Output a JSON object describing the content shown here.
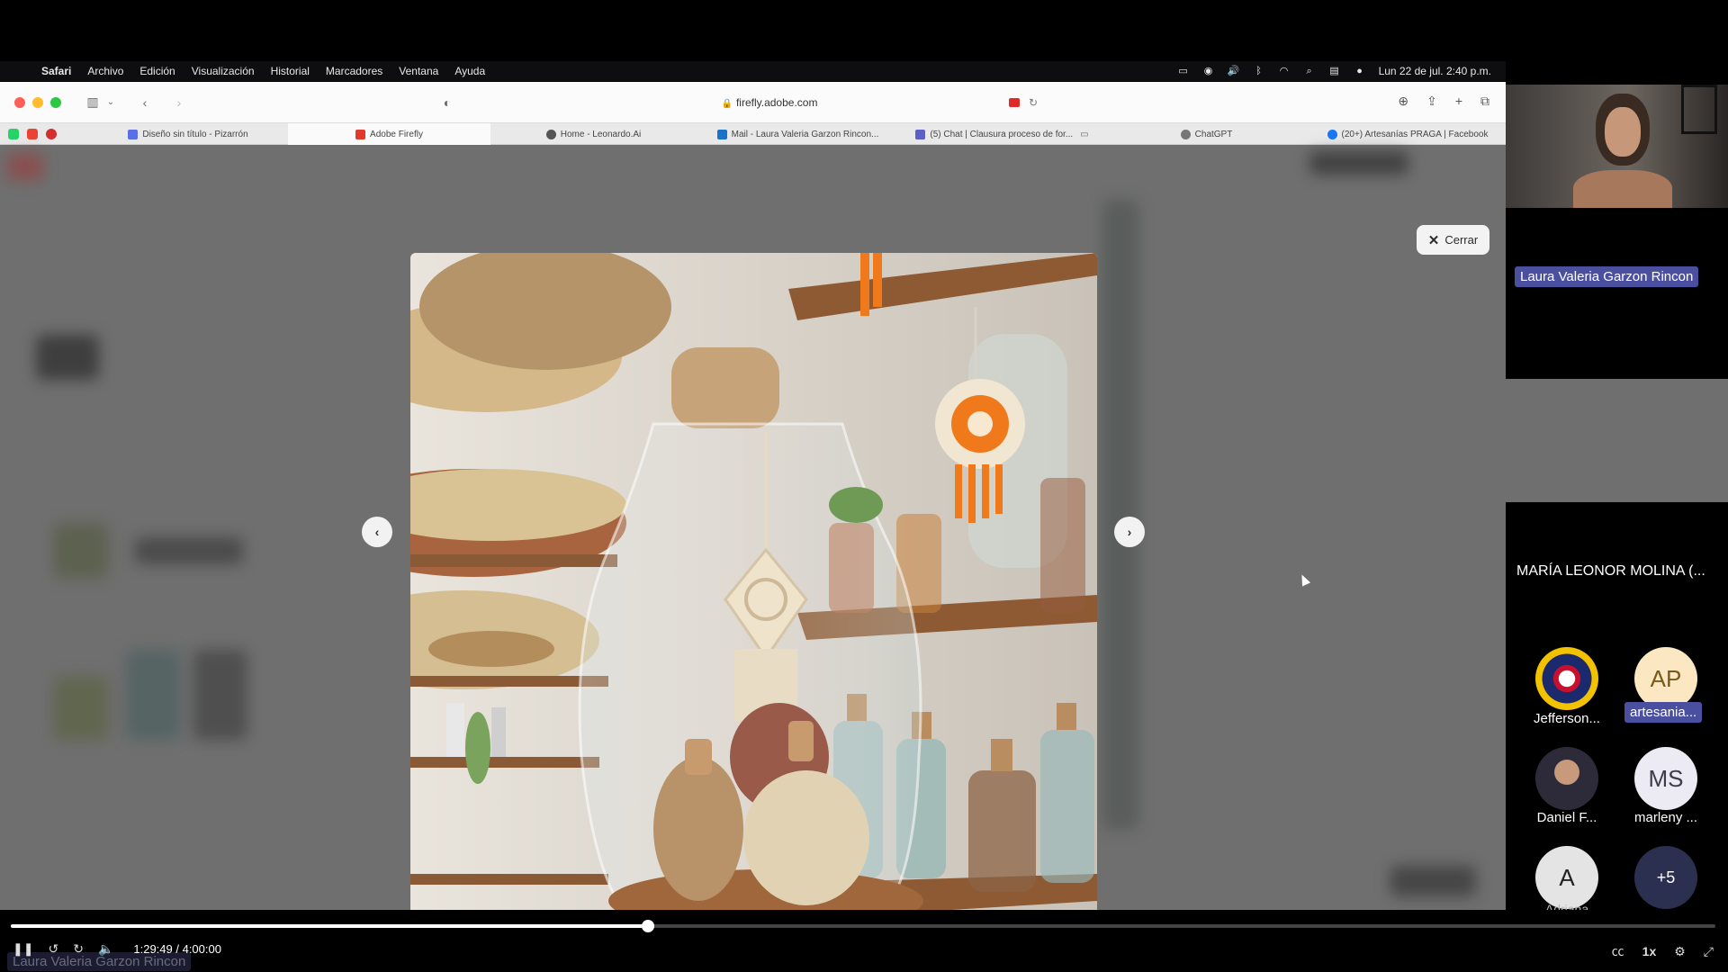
{
  "menubar": {
    "app": "Safari",
    "items": [
      "Archivo",
      "Edición",
      "Visualización",
      "Historial",
      "Marcadores",
      "Ventana",
      "Ayuda"
    ],
    "clock": "Lun 22 de jul.  2:40 p.m."
  },
  "browser": {
    "url": "firefly.adobe.com",
    "tabs": [
      {
        "label": "Diseño sin título - Pizarrón",
        "active": false
      },
      {
        "label": "Adobe Firefly",
        "active": true
      },
      {
        "label": "Home - Leonardo.Ai",
        "active": false
      },
      {
        "label": "Mail - Laura Valeria Garzon Rincon...",
        "active": false
      },
      {
        "label": "(5) Chat | Clausura proceso de for...",
        "active": false
      },
      {
        "label": "ChatGPT",
        "active": false
      },
      {
        "label": "(20+) Artesanías PRAGA | Facebook",
        "active": false
      }
    ]
  },
  "viewer": {
    "close_label": "Cerrar",
    "prev_icon": "‹",
    "next_icon": "›"
  },
  "participants": {
    "main_speaker": "Laura Valeria Garzon Rincon",
    "second": "MARÍA LEONOR MOLINA (...",
    "grid": [
      {
        "initials": "",
        "name": "Jefferson...",
        "highlight": false
      },
      {
        "initials": "AP",
        "name": "artesania...",
        "highlight": true
      },
      {
        "initials": "",
        "name": "Daniel F...",
        "highlight": false
      },
      {
        "initials": "MS",
        "name": "marleny ...",
        "highlight": false
      },
      {
        "initials": "A",
        "name": "Adriana",
        "highlight": false
      },
      {
        "initials": "+5",
        "name": "",
        "highlight": false
      }
    ]
  },
  "player": {
    "time": "1:29:49 / 4:00:00",
    "progress": 0.374,
    "speed": "1x",
    "caption_ghost": "Laura Valeria Garzon Rincon"
  }
}
